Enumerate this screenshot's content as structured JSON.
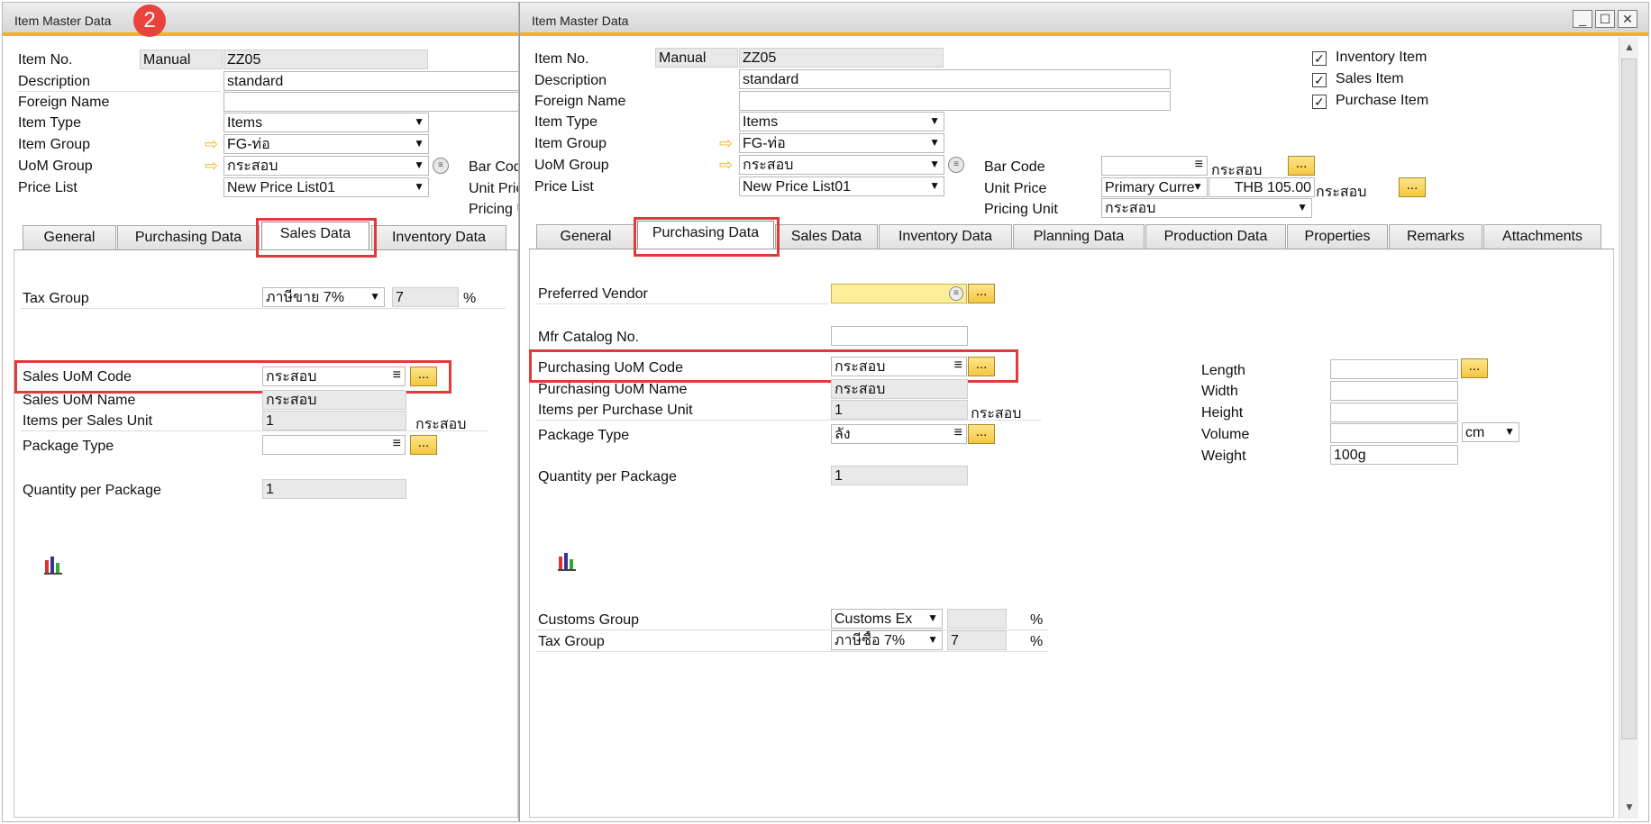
{
  "left": {
    "title": "Item Master Data",
    "badge": "2",
    "item_no_label": "Item No.",
    "series": "Manual",
    "item_no": "ZZ05",
    "description_label": "Description",
    "description": "standard",
    "foreign_name_label": "Foreign Name",
    "item_type_label": "Item Type",
    "item_type": "Items",
    "item_group_label": "Item Group",
    "item_group": "FG-ท่อ",
    "uom_group_label": "UoM Group",
    "uom_group": "กระสอบ",
    "price_list_label": "Price List",
    "price_list": "New Price List01",
    "bar_code_label": "Bar Cod",
    "unit_price_label": "Unit Pric",
    "pricing_label": "Pricing U",
    "tabs": [
      "General",
      "Purchasing Data",
      "Sales Data",
      "Inventory Data"
    ],
    "tax_group_label": "Tax Group",
    "tax_group": "ภาษีขาย 7%",
    "tax_rate": "7",
    "pct": "%",
    "sales_uom_code_label": "Sales UoM Code",
    "sales_uom_code": "กระสอบ",
    "sales_uom_name_label": "Sales UoM Name",
    "sales_uom_name": "กระสอบ",
    "items_per_sales_unit_label": "Items per Sales Unit",
    "items_per_sales_unit": "1",
    "items_per_sales_unit_uom": "กระสอบ",
    "package_type_label": "Package Type",
    "qty_per_package_label": "Quantity per Package",
    "qty_per_package": "1",
    "dots": "..."
  },
  "right": {
    "title": "Item Master Data",
    "item_no_label": "Item No.",
    "series": "Manual",
    "item_no": "ZZ05",
    "description_label": "Description",
    "description": "standard",
    "foreign_name_label": "Foreign Name",
    "item_type_label": "Item Type",
    "item_type": "Items",
    "item_group_label": "Item Group",
    "item_group": "FG-ท่อ",
    "uom_group_label": "UoM Group",
    "uom_group": "กระสอบ",
    "price_list_label": "Price List",
    "price_list": "New Price List01",
    "inventory_item": "Inventory Item",
    "sales_item": "Sales Item",
    "purchase_item": "Purchase Item",
    "bar_code_label": "Bar Code",
    "bar_code_uom": "กระสอบ",
    "unit_price_label": "Unit Price",
    "unit_price_currency": "Primary Curre",
    "unit_price_value": "THB 105.00",
    "unit_price_uom": "กระสอบ",
    "pricing_unit_label": "Pricing Unit",
    "pricing_unit": "กระสอบ",
    "tabs": [
      "General",
      "Purchasing Data",
      "Sales Data",
      "Inventory Data",
      "Planning Data",
      "Production Data",
      "Properties",
      "Remarks",
      "Attachments"
    ],
    "preferred_vendor_label": "Preferred Vendor",
    "mfr_catalog_label": "Mfr Catalog No.",
    "purch_uom_code_label": "Purchasing UoM Code",
    "purch_uom_code": "กระสอบ",
    "purch_uom_name_label": "Purchasing UoM Name",
    "purch_uom_name": "กระสอบ",
    "items_per_purch_unit_label": "Items per Purchase Unit",
    "items_per_purch_unit": "1",
    "items_per_purch_unit_uom": "กระสอบ",
    "package_type_label": "Package Type",
    "package_type": "ลัง",
    "qty_per_package_label": "Quantity per Package",
    "qty_per_package": "1",
    "length_label": "Length",
    "width_label": "Width",
    "height_label": "Height",
    "volume_label": "Volume",
    "volume_unit": "cm",
    "weight_label": "Weight",
    "weight": "100g",
    "customs_group_label": "Customs Group",
    "customs_group": "Customs Ex",
    "tax_group_label": "Tax Group",
    "tax_group": "ภาษีซื้อ 7%",
    "tax_rate": "7",
    "pct": "%",
    "dots": "..."
  },
  "colors": {
    "accent": "#f0b321",
    "highlight": "#e03a3a",
    "button": "#f5c73f"
  },
  "icons": [
    "arrow-right-icon",
    "list-icon",
    "chevron-down-icon",
    "chart-icon",
    "minimize-icon",
    "maximize-icon",
    "close-icon"
  ]
}
